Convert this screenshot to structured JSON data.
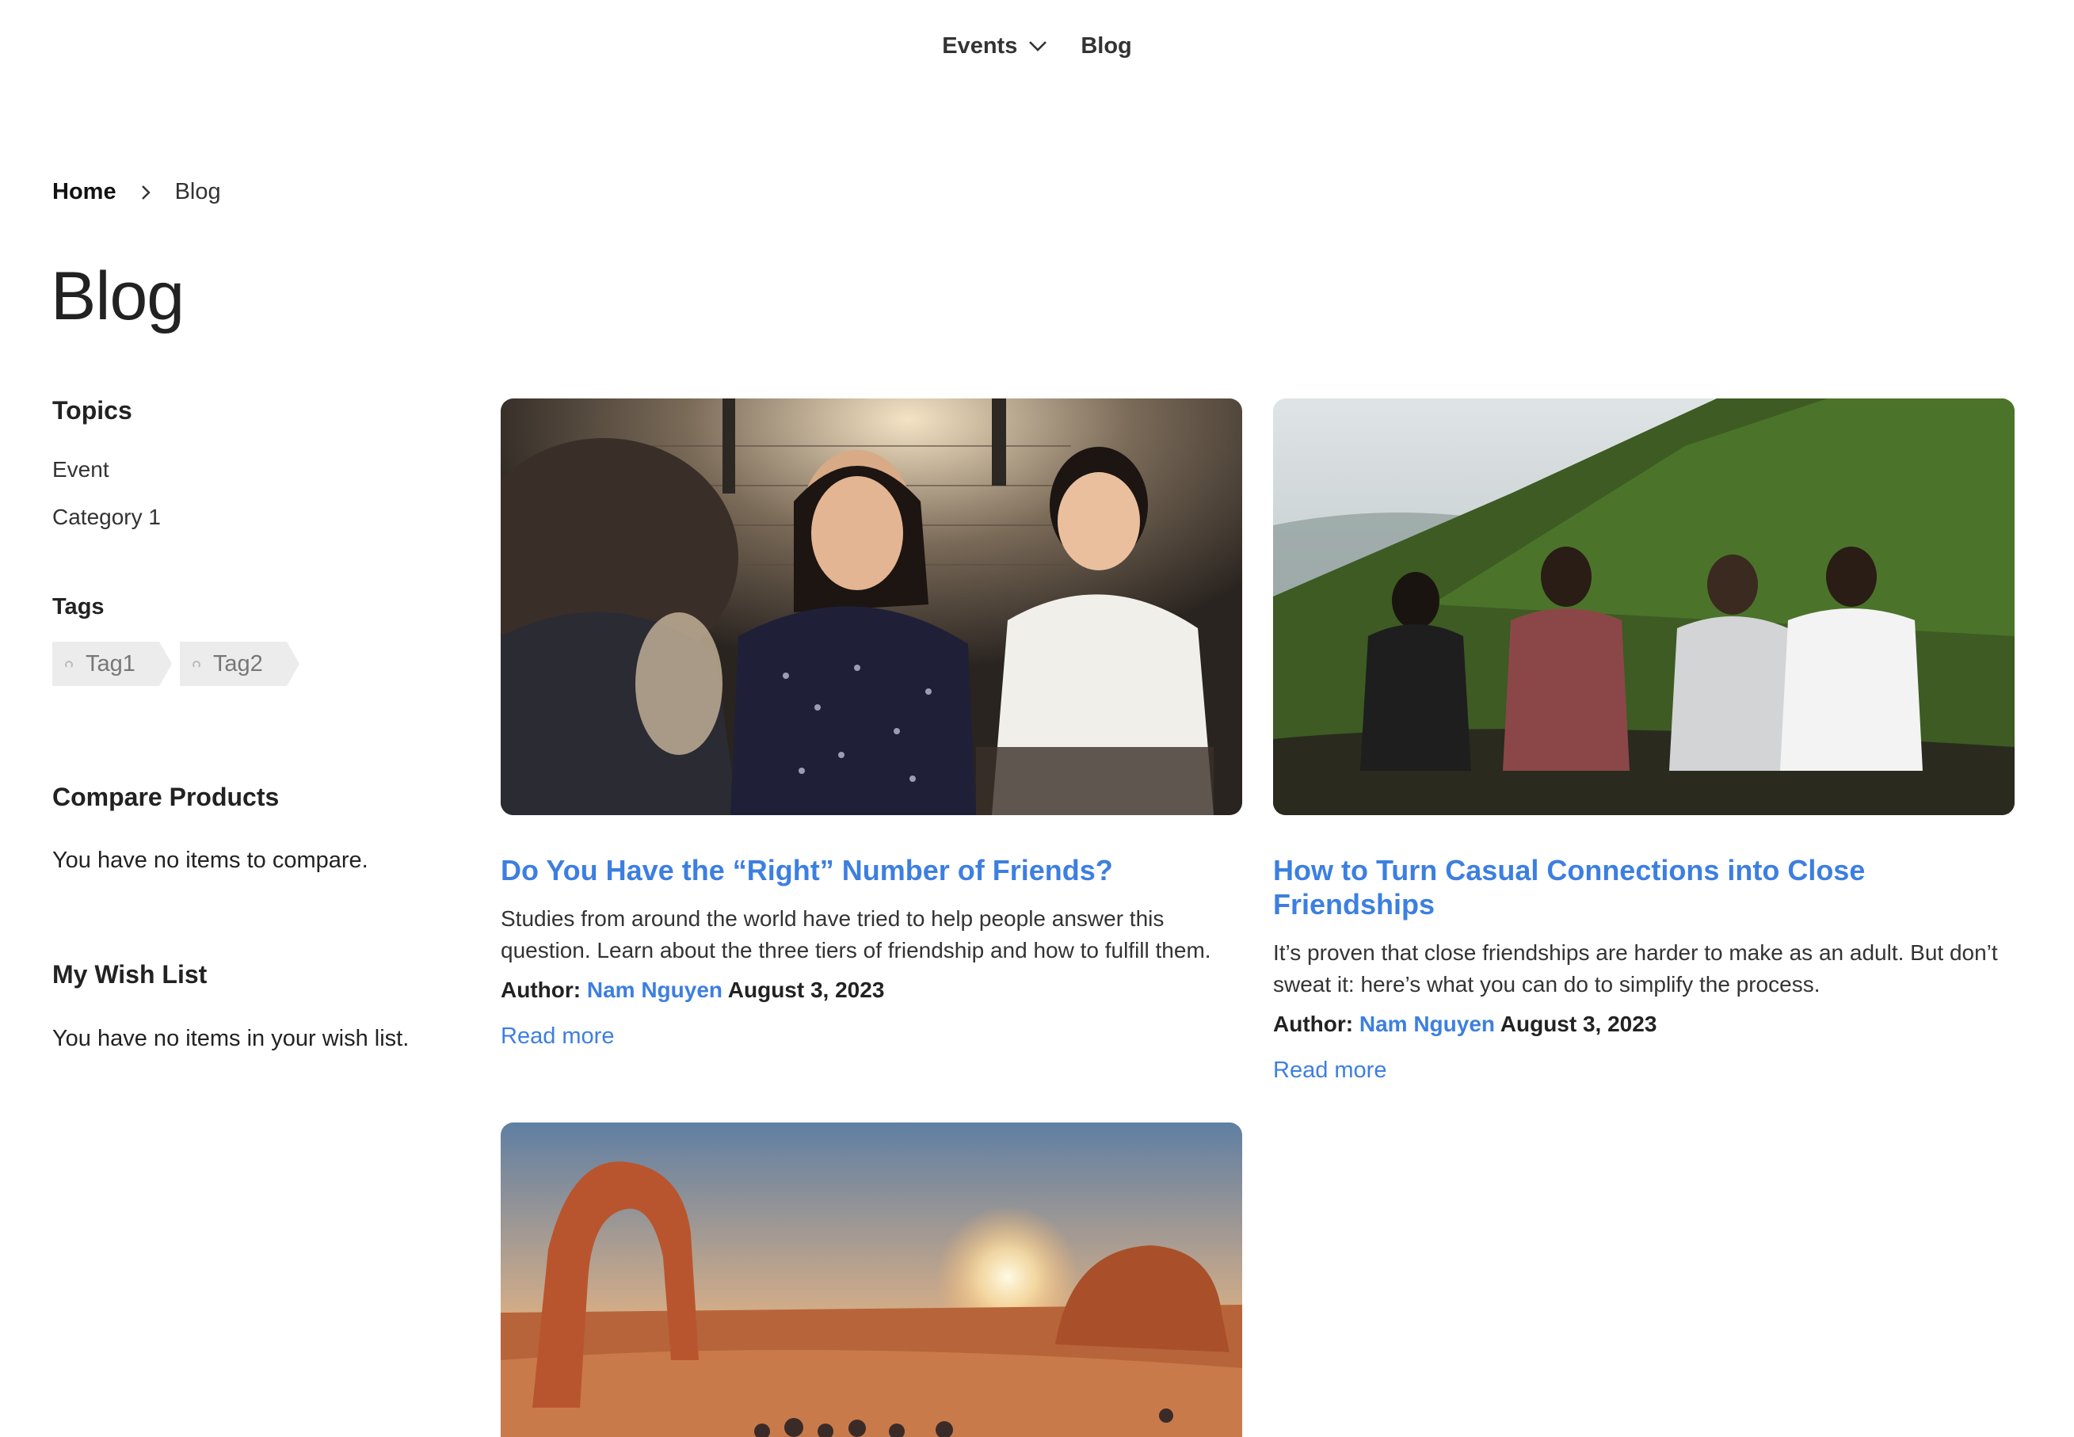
{
  "nav": {
    "events_label": "Events",
    "blog_label": "Blog"
  },
  "breadcrumb": {
    "home": "Home",
    "current": "Blog"
  },
  "page_title": "Blog",
  "sidebar": {
    "topics_heading": "Topics",
    "topics": [
      "Event",
      "Category 1"
    ],
    "tags_heading": "Tags",
    "tags": [
      "Tag1",
      "Tag2"
    ],
    "compare_heading": "Compare Products",
    "compare_text": "You have no items to compare.",
    "wish_heading": "My Wish List",
    "wish_text": "You have no items in your wish list."
  },
  "posts": [
    {
      "title": "Do You Have the “Right” Number of Friends?",
      "description": "Studies from around the world have tried to help people answer this question. Learn about the three tiers of friendship and how to fulfill them.",
      "author_label": "Author:",
      "author": "Nam Nguyen",
      "date": "August 3, 2023",
      "read_more": "Read more"
    },
    {
      "title": "How to Turn Casual Connections into Close Friendships",
      "description": "It’s proven that close friendships are harder to make as an adult. But don’t sweat it: here’s what you can do to simplify the process.",
      "author_label": "Author:",
      "author": "Nam Nguyen",
      "date": "August 3, 2023",
      "read_more": "Read more"
    }
  ],
  "colors": {
    "link": "#3d7fe0",
    "tag_bg": "#ececec"
  }
}
